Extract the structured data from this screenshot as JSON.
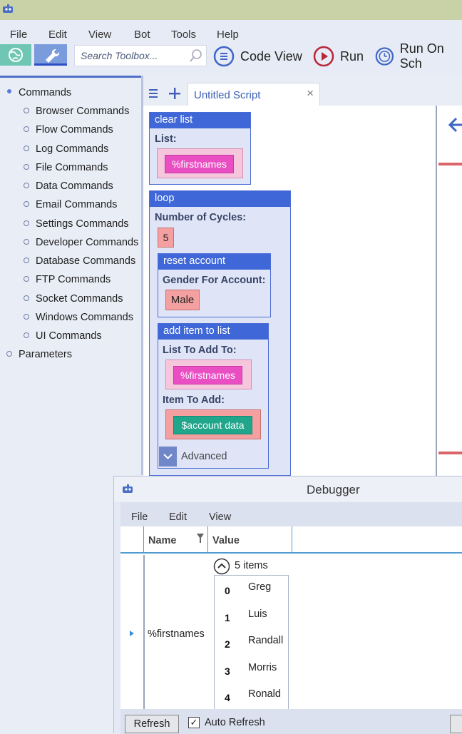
{
  "menu": {
    "file": "File",
    "edit": "Edit",
    "view": "View",
    "bot": "Bot",
    "tools": "Tools",
    "help": "Help"
  },
  "toolbar": {
    "search_placeholder": "Search Toolbox...",
    "code_view": "Code View",
    "run": "Run",
    "run_on_schedule": "Run On Sch"
  },
  "sidebar": {
    "root": "Commands",
    "items": [
      "Browser Commands",
      "Flow Commands",
      "Log Commands",
      "File Commands",
      "Data Commands",
      "Email Commands",
      "Settings Commands",
      "Developer Commands",
      "Database Commands",
      "FTP Commands",
      "Socket Commands",
      "Windows Commands",
      "UI Commands"
    ],
    "parameters": "Parameters"
  },
  "tabs": {
    "menu_icon": "hamburger-icon",
    "add_icon": "plus-icon",
    "active_title": "Untitled Script",
    "close": "×"
  },
  "script": {
    "clear_list": {
      "title": "clear list",
      "label": "List:",
      "value": "%firstnames"
    },
    "loop": {
      "title": "loop",
      "label": "Number of Cycles:",
      "value": "5"
    },
    "reset_account": {
      "title": "reset account",
      "label": "Gender For Account:",
      "value": "Male"
    },
    "add_item": {
      "title": "add item to list",
      "list_label": "List To Add To:",
      "list_value": "%firstnames",
      "item_label": "Item To Add:",
      "item_value": "$account data",
      "advanced": "Advanced"
    }
  },
  "debugger": {
    "title": "Debugger",
    "menu": {
      "file": "File",
      "edit": "Edit",
      "view": "View"
    },
    "columns": {
      "name": "Name",
      "value": "Value"
    },
    "row": {
      "name": "%firstnames",
      "count": "5 items"
    },
    "items": [
      {
        "index": "0",
        "value": "Greg"
      },
      {
        "index": "1",
        "value": "Luis"
      },
      {
        "index": "2",
        "value": "Randall"
      },
      {
        "index": "3",
        "value": "Morris"
      },
      {
        "index": "4",
        "value": "Ronald"
      }
    ],
    "refresh": "Refresh",
    "auto_refresh": "Auto Refresh",
    "auto_refresh_checked": "✓"
  },
  "colors": {
    "accent": "#3f67d8",
    "variable_pill": "#e94fc3",
    "value_pill": "#f4a0a0",
    "data_pill": "#1fa68b"
  }
}
